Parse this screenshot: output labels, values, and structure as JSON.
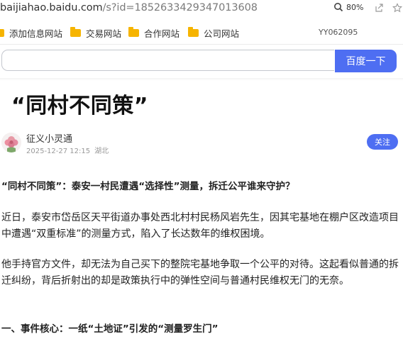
{
  "browser": {
    "url_host": "baijiahao.baidu.com",
    "url_path": "/s?id=1852633429347013608",
    "zoom": "80%",
    "icons": [
      "zoom-icon",
      "share-icon",
      "star-icon"
    ]
  },
  "bookmarks": {
    "items": [
      {
        "label": "添加信息网站"
      },
      {
        "label": "交易网站"
      },
      {
        "label": "合作网站"
      },
      {
        "label": "公司网站"
      }
    ],
    "code": "YY062095"
  },
  "search": {
    "value": "",
    "button_label": "百度一下"
  },
  "article": {
    "title": "“同村不同策”",
    "author": {
      "name": "征义小灵通",
      "date": "2025-12-27 12:15",
      "location": "湖北",
      "follow_label": "关注"
    },
    "paragraphs": [
      "“同村不同策”：泰安一村民遭遇“选择性”测量，拆迁公平谁来守护？",
      "近日，泰安市岱岳区天平街道办事处西北村村民杨风岩先生，因其宅基地在棚户区改造项目中遭遇“双重标准”的测量方式，陷入了长达数年的维权困境。",
      "他手持官方文件，却无法为自己买下的整院宅基地争取一个公平的对待。这起看似普通的拆迁纠纷，背后折射出的却是政策执行中的弹性空间与普通村民维权无门的无奈。",
      "一、事件核心：一纸“土地证”引发的“测量罗生门”"
    ]
  },
  "colors": {
    "accent": "#4e6ef2",
    "folder": "#f6b400"
  }
}
